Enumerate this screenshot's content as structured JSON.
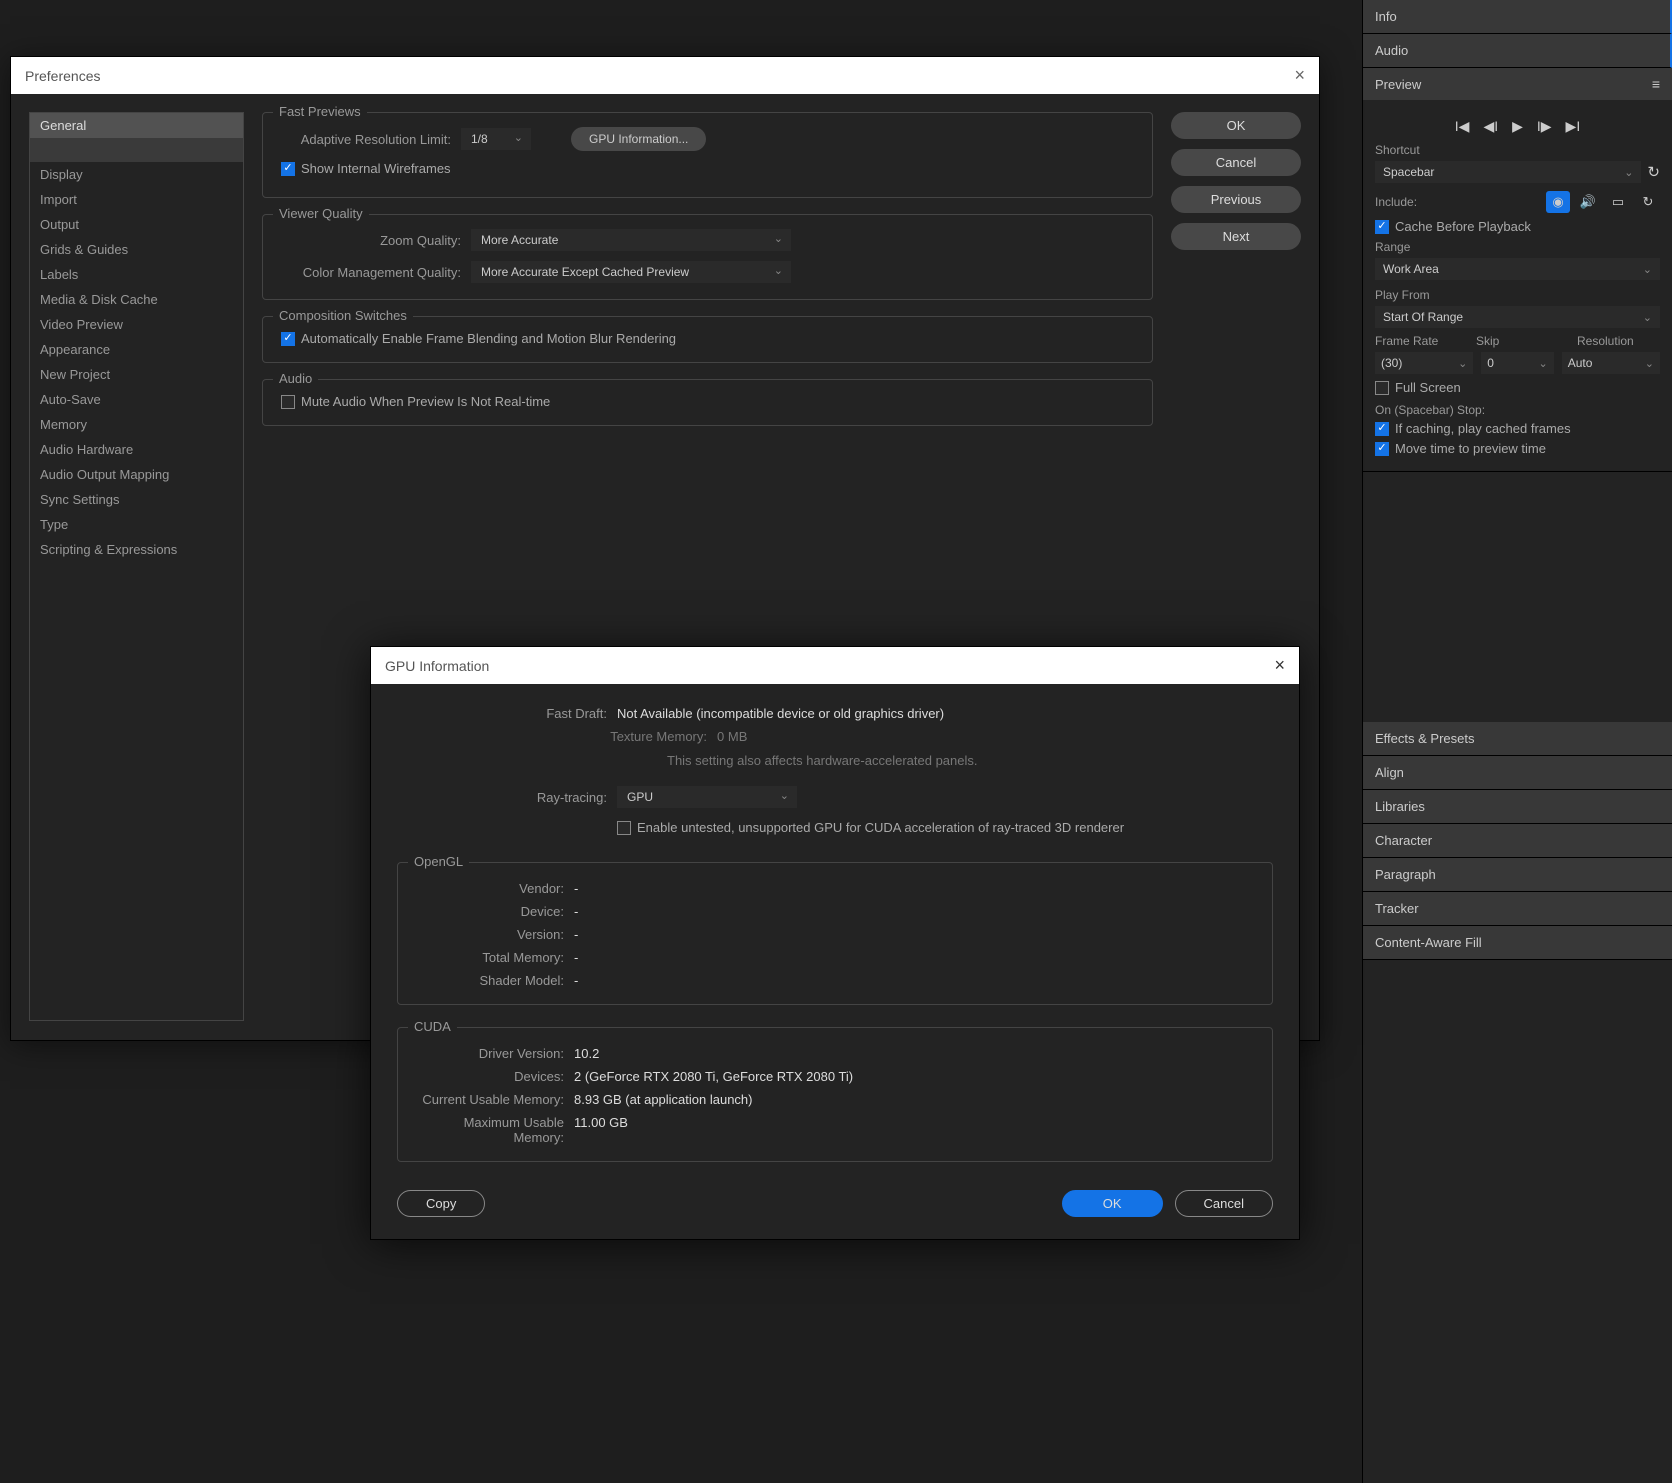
{
  "rightPanel": {
    "info": "Info",
    "audio": "Audio",
    "preview": "Preview",
    "shortcut_label": "Shortcut",
    "shortcut_value": "Spacebar",
    "include_label": "Include:",
    "cache_before": "Cache Before Playback",
    "range_label": "Range",
    "range_value": "Work Area",
    "playfrom_label": "Play From",
    "playfrom_value": "Start Of Range",
    "framerate_label": "Frame Rate",
    "skip_label": "Skip",
    "resolution_label": "Resolution",
    "framerate_value": "(30)",
    "skip_value": "0",
    "resolution_value": "Auto",
    "fullscreen": "Full Screen",
    "onstop_label": "On (Spacebar) Stop:",
    "if_caching": "If caching, play cached frames",
    "move_time": "Move time to preview time",
    "panels": [
      "Effects & Presets",
      "Align",
      "Libraries",
      "Character",
      "Paragraph",
      "Tracker",
      "Content-Aware Fill"
    ]
  },
  "prefs": {
    "title": "Preferences",
    "sidebar": [
      "General",
      "",
      "Display",
      "Import",
      "Output",
      "Grids & Guides",
      "Labels",
      "Media & Disk Cache",
      "Video Preview",
      "Appearance",
      "New Project",
      "Auto-Save",
      "Memory",
      "Audio Hardware",
      "Audio Output Mapping",
      "Sync Settings",
      "Type",
      "Scripting & Expressions"
    ],
    "buttons": {
      "ok": "OK",
      "cancel": "Cancel",
      "previous": "Previous",
      "next": "Next"
    },
    "fastPreviews": {
      "legend": "Fast Previews",
      "adaptive_label": "Adaptive Resolution Limit:",
      "adaptive_value": "1/8",
      "gpu_btn": "GPU Information...",
      "show_wireframes": "Show Internal Wireframes"
    },
    "viewerQuality": {
      "legend": "Viewer Quality",
      "zoom_label": "Zoom Quality:",
      "zoom_value": "More Accurate",
      "color_label": "Color Management Quality:",
      "color_value": "More Accurate Except Cached Preview"
    },
    "compSwitches": {
      "legend": "Composition Switches",
      "auto_enable": "Automatically Enable Frame Blending and Motion Blur Rendering"
    },
    "audio": {
      "legend": "Audio",
      "mute": "Mute Audio When Preview Is Not Real-time"
    }
  },
  "gpu": {
    "title": "GPU Information",
    "fastdraft_label": "Fast Draft:",
    "fastdraft_value": "Not Available (incompatible device or old graphics driver)",
    "texmem_label": "Texture Memory:",
    "texmem_value": "0",
    "texmem_unit": "MB",
    "texmem_note": "This setting also affects hardware-accelerated panels.",
    "raytracing_label": "Ray-tracing:",
    "raytracing_value": "GPU",
    "enable_untested": "Enable untested, unsupported GPU for CUDA acceleration of ray-traced 3D renderer",
    "opengl": {
      "legend": "OpenGL",
      "vendor_label": "Vendor:",
      "vendor_value": "-",
      "device_label": "Device:",
      "device_value": "-",
      "version_label": "Version:",
      "version_value": "-",
      "totalmem_label": "Total Memory:",
      "totalmem_value": "-",
      "shader_label": "Shader Model:",
      "shader_value": "-"
    },
    "cuda": {
      "legend": "CUDA",
      "driver_label": "Driver Version:",
      "driver_value": "10.2",
      "devices_label": "Devices:",
      "devices_value": "2 (GeForce RTX 2080 Ti, GeForce RTX 2080 Ti)",
      "currmem_label": "Current Usable Memory:",
      "currmem_value": "8.93 GB (at application launch)",
      "maxmem_label": "Maximum Usable Memory:",
      "maxmem_value": "11.00 GB"
    },
    "buttons": {
      "copy": "Copy",
      "ok": "OK",
      "cancel": "Cancel"
    }
  }
}
